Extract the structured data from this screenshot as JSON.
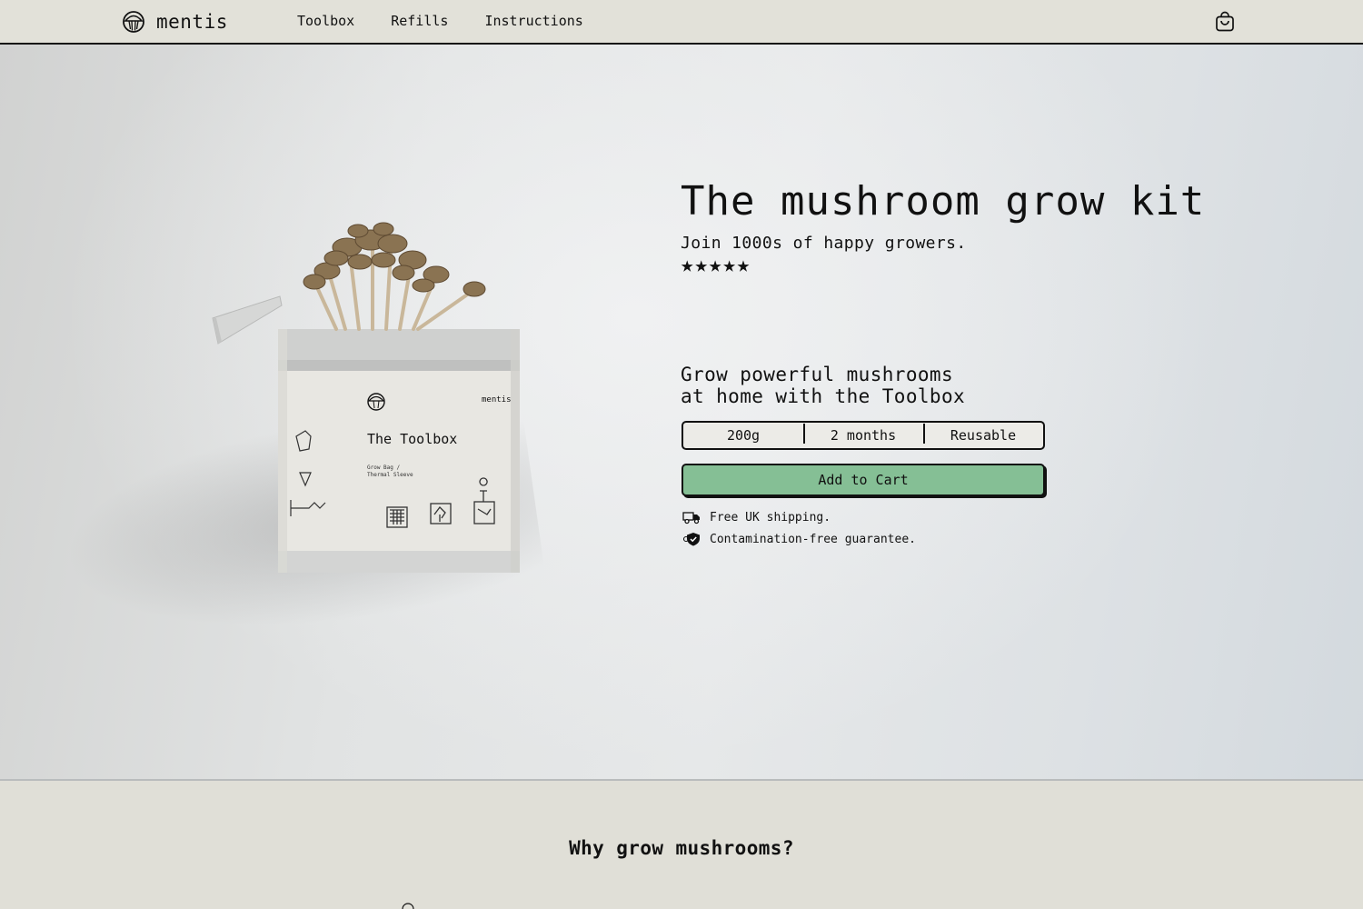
{
  "nav": {
    "brand": "mentis",
    "links": [
      {
        "label": "Toolbox"
      },
      {
        "label": "Refills"
      },
      {
        "label": "Instructions"
      }
    ]
  },
  "hero": {
    "title": "The mushroom grow kit",
    "subtitle": "Join 1000s of happy growers.",
    "rating_stars": "★★★★★",
    "rating_value": 5,
    "pitch_line_1": "Grow powerful mushrooms",
    "pitch_line_2": "at home with the Toolbox",
    "specs": [
      {
        "label": "200g"
      },
      {
        "label": "2 months"
      },
      {
        "label": "Reusable"
      }
    ],
    "cta_label": "Add to Cart",
    "perks": [
      {
        "text": "Free UK shipping.",
        "icon": "delivery-truck-icon"
      },
      {
        "text": "Contamination-free guarantee.",
        "icon": "shield-check-icon"
      }
    ]
  },
  "product_tin": {
    "brand": "mentis",
    "name": "The Toolbox",
    "contents_line_1": "Grow Bag /",
    "contents_line_2": "Thermal Sleeve"
  },
  "why": {
    "title": "Why grow mushrooms?"
  },
  "colors": {
    "cta": "#85bf95",
    "nav_bg": "#e2e1d9",
    "ink": "#111111"
  }
}
